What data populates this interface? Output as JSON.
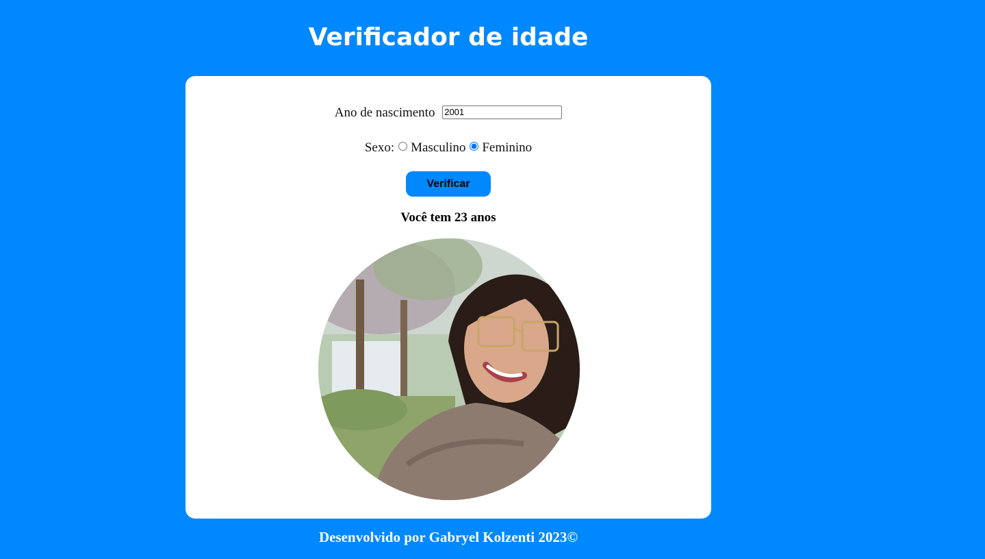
{
  "page": {
    "title": "Verificador de idade",
    "background_color": "#0088ff"
  },
  "form": {
    "year_label": "Ano de nascimento",
    "year_value": "2001",
    "sex_label": "Sexo:",
    "options": [
      {
        "label": "Masculino",
        "checked": false
      },
      {
        "label": "Feminino",
        "checked": true
      }
    ],
    "button_label": "Verificar",
    "button_color": "#0088ff"
  },
  "result": {
    "text": "Você tem 23 anos"
  },
  "footer": {
    "text": "Desenvolvido por Gabryel Kolzenti 2023©"
  }
}
